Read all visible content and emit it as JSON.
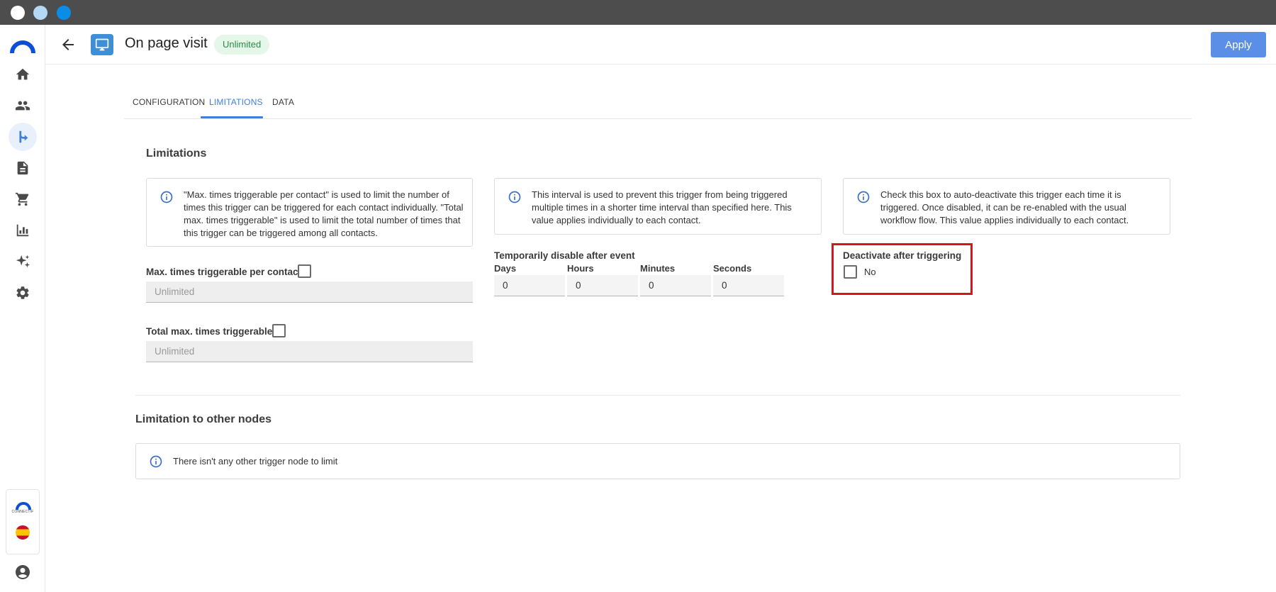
{
  "header": {
    "title": "On page visit",
    "badge": "Unlimited",
    "apply_label": "Apply"
  },
  "tabs": [
    {
      "label": "CONFIGURATION",
      "active": false
    },
    {
      "label": "LIMITATIONS",
      "active": true
    },
    {
      "label": "DATA",
      "active": false
    }
  ],
  "sidebar": {
    "items": [
      {
        "icon": "home-icon"
      },
      {
        "icon": "contacts-icon"
      },
      {
        "icon": "workflow-icon",
        "active": true
      },
      {
        "icon": "document-icon"
      },
      {
        "icon": "cart-icon"
      },
      {
        "icon": "chart-icon"
      },
      {
        "icon": "sparkle-icon"
      },
      {
        "icon": "gear-icon"
      }
    ],
    "brand_text": "CONNECTIF"
  },
  "limitations": {
    "title": "Limitations",
    "max_info": "\"Max. times triggerable per contact\" is used to limit the number of times this trigger can be triggered for each contact individually. \"Total max. times triggerable\" is used to limit the total number of times that this trigger can be triggered among all contacts.",
    "interval_info": "This interval is used to prevent this trigger from being triggered multiple times in a shorter time interval than specified here. This value applies individually to each contact.",
    "deactivate_info": "Check this box to auto-deactivate this trigger each time it is triggered. Once disabled, it can be re-enabled with the usual workflow flow. This value applies individually to each contact.",
    "max_per_contact_label": "Max. times triggerable per contact",
    "max_per_contact_placeholder": "Unlimited",
    "total_max_label": "Total max. times triggerable",
    "total_max_placeholder": "Unlimited",
    "temp_disable_label": "Temporarily disable after event",
    "days_label": "Days",
    "hours_label": "Hours",
    "minutes_label": "Minutes",
    "seconds_label": "Seconds",
    "days_value": "0",
    "hours_value": "0",
    "minutes_value": "0",
    "seconds_value": "0",
    "deactivate_label": "Deactivate after triggering",
    "deactivate_value": "No"
  },
  "other_nodes": {
    "title": "Limitation to other nodes",
    "info": "There isn't any other trigger node to limit"
  },
  "colors": {
    "accent": "#3f7fe0",
    "apply_button": "#5b8ee6",
    "badge_bg": "#e4f7e8",
    "badge_text": "#2e8b45",
    "highlight": "#d8141d"
  }
}
